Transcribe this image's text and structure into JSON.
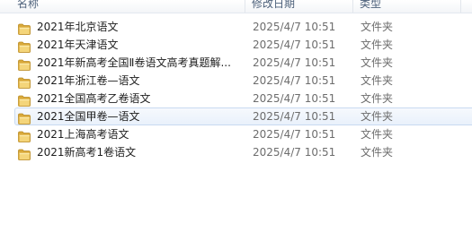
{
  "header": {
    "name_label": "名称",
    "date_label": "修改日期",
    "type_label": "类型"
  },
  "files": [
    {
      "name": "2021年北京语文",
      "date": "2025/4/7 10:51",
      "type": "文件夹",
      "selected": false
    },
    {
      "name": "2021年天津语文",
      "date": "2025/4/7 10:51",
      "type": "文件夹",
      "selected": false
    },
    {
      "name": "2021年新高考全国Ⅱ卷语文高考真题解...",
      "date": "2025/4/7 10:51",
      "type": "文件夹",
      "selected": false
    },
    {
      "name": "2021年浙江卷—语文",
      "date": "2025/4/7 10:51",
      "type": "文件夹",
      "selected": false
    },
    {
      "name": "2021全国高考乙卷语文",
      "date": "2025/4/7 10:51",
      "type": "文件夹",
      "selected": false
    },
    {
      "name": "2021全国甲卷—语文",
      "date": "2025/4/7 10:51",
      "type": "文件夹",
      "selected": true
    },
    {
      "name": "2021上海高考语文",
      "date": "2025/4/7 10:51",
      "type": "文件夹",
      "selected": false
    },
    {
      "name": "2021新高考1卷语文",
      "date": "2025/4/7 10:51",
      "type": "文件夹",
      "selected": false
    }
  ],
  "icons": {
    "folder": "folder-icon"
  },
  "colors": {
    "selection_bg": "#e9f1fb",
    "selection_border": "#c8daf1",
    "folder": "#e8bf4a"
  }
}
